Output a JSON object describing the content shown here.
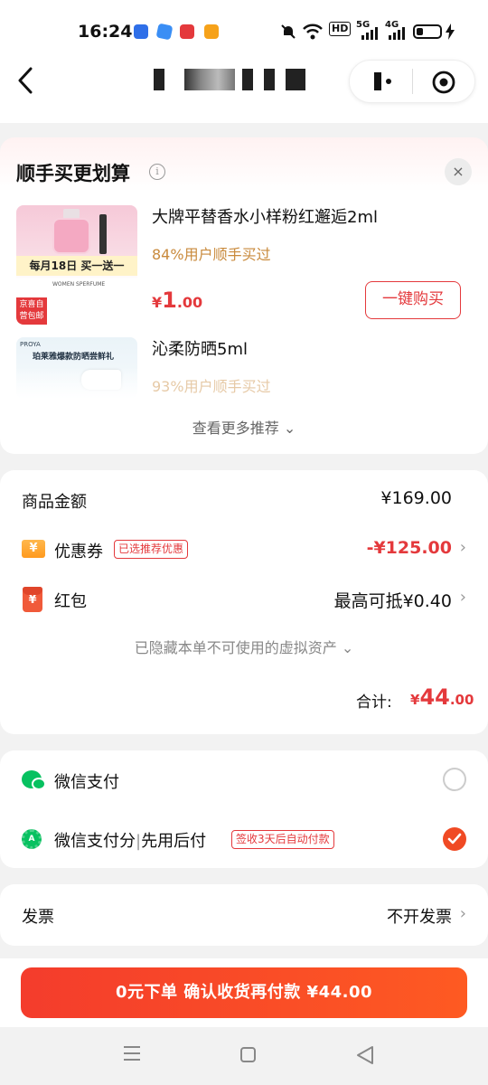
{
  "status_bar": {
    "time": "16:24",
    "battery_icon": "battery-icon",
    "network_labels": [
      "HD",
      "5G",
      "4G"
    ]
  },
  "nav": {
    "back_icon": "chevron-left-icon",
    "title_redacted": true,
    "more_icon": "more-dots-icon",
    "close_icon": "target-circle-icon"
  },
  "recommend": {
    "title": "顺手买更划算",
    "info_icon": "i",
    "close_icon": "×",
    "products": [
      {
        "name": "大牌平替香水小样粉红邂逅2ml",
        "buyers": "84%用户顺手买过",
        "price_currency": "¥",
        "price_int": "1",
        "price_dec": ".00",
        "buy_label": "一键购买",
        "image_banner": "每月18日 买一送一",
        "image_tag": "京喜自营包邮",
        "image_caption": "WOMEN SPERFUME"
      },
      {
        "name": "沁柔防晒5ml",
        "buyers": "93%用户顺手买过",
        "image_brand": "PROYA",
        "image_title": "珀莱雅爆款防晒尝鲜礼"
      }
    ],
    "see_more": "查看更多推荐 ⌄"
  },
  "amount": {
    "goods_label": "商品金额",
    "goods_value": "¥169.00",
    "coupon_icon": "¥",
    "coupon_label": "优惠券",
    "coupon_tag": "已选推荐优惠",
    "coupon_value": "-¥125.00",
    "redpack_icon": "¥",
    "redpack_label": "红包",
    "redpack_value": "最高可抵¥0.40",
    "hidden_note": "已隐藏本单不可使用的虚拟资产 ⌄",
    "total_label": "合计:",
    "total_currency": "¥",
    "total_int": "44",
    "total_dec": ".00",
    "chevron": "›"
  },
  "payment": {
    "wechat_label": "微信支付",
    "wxscore_label_a": "微信支付分",
    "wxscore_sep": "|",
    "wxscore_label_b": "先用后付",
    "wxscore_tag": "签收3天后自动付款",
    "wxscore_icon_text": "A",
    "selected": "wxscore",
    "accent": "#f04a24"
  },
  "invoice": {
    "label": "发票",
    "value": "不开发票",
    "chevron": "›"
  },
  "order_button": "0元下单  确认收货再付款  ¥44.00",
  "colors": {
    "brand_red": "#e4393c",
    "wechat_green": "#07c160",
    "buyers_gold": "#c98a3c"
  }
}
